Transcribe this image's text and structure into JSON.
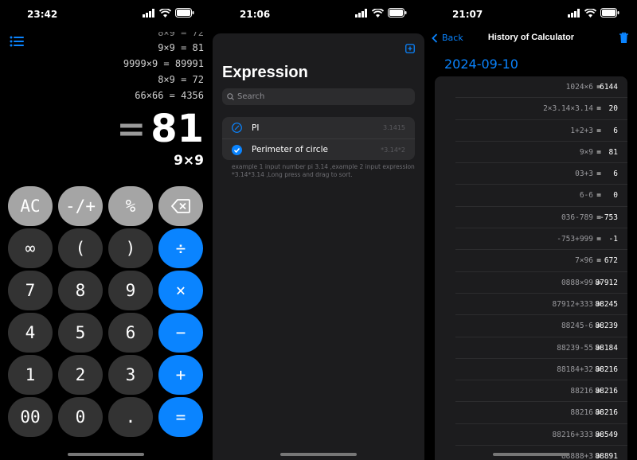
{
  "screens": {
    "calculator": {
      "time": "23:42",
      "history": [
        {
          "expr": "8×9 = 72",
          "cut": true
        },
        {
          "expr": "9×9 = 81"
        },
        {
          "expr": "9999×9 = 89991"
        },
        {
          "expr": "8×9 = 72"
        },
        {
          "expr": "66×66 = 4356"
        }
      ],
      "result_eq": "=",
      "result": "81",
      "expression": "9×9",
      "keys": [
        {
          "label": "AC",
          "kind": "fn",
          "name": "ac-key"
        },
        {
          "label": "-/+",
          "kind": "fn",
          "name": "negate-key"
        },
        {
          "label": "%",
          "kind": "fn",
          "name": "percent-key"
        },
        {
          "label": "",
          "kind": "fn",
          "name": "backspace-key",
          "icon": "delete-left-icon"
        },
        {
          "label": "∞",
          "kind": "num",
          "name": "infinity-key"
        },
        {
          "label": "(",
          "kind": "num",
          "name": "open-paren-key"
        },
        {
          "label": ")",
          "kind": "num",
          "name": "close-paren-key"
        },
        {
          "label": "÷",
          "kind": "op",
          "name": "divide-key"
        },
        {
          "label": "7",
          "kind": "num",
          "name": "digit-7-key"
        },
        {
          "label": "8",
          "kind": "num",
          "name": "digit-8-key"
        },
        {
          "label": "9",
          "kind": "num",
          "name": "digit-9-key"
        },
        {
          "label": "×",
          "kind": "op",
          "name": "multiply-key"
        },
        {
          "label": "4",
          "kind": "num",
          "name": "digit-4-key"
        },
        {
          "label": "5",
          "kind": "num",
          "name": "digit-5-key"
        },
        {
          "label": "6",
          "kind": "num",
          "name": "digit-6-key"
        },
        {
          "label": "−",
          "kind": "op",
          "name": "minus-key"
        },
        {
          "label": "1",
          "kind": "num",
          "name": "digit-1-key"
        },
        {
          "label": "2",
          "kind": "num",
          "name": "digit-2-key"
        },
        {
          "label": "3",
          "kind": "num",
          "name": "digit-3-key"
        },
        {
          "label": "+",
          "kind": "op",
          "name": "plus-key"
        },
        {
          "label": "00",
          "kind": "num",
          "name": "double-zero-key"
        },
        {
          "label": "0",
          "kind": "num",
          "name": "digit-0-key"
        },
        {
          "label": ".",
          "kind": "num",
          "name": "decimal-key"
        },
        {
          "label": "=",
          "kind": "op",
          "name": "equals-key"
        }
      ]
    },
    "expressions": {
      "time": "21:06",
      "title": "Expression",
      "search_placeholder": "Search",
      "items": [
        {
          "label": "PI",
          "value": "3.1415",
          "checked": false
        },
        {
          "label": "Perimeter of circle",
          "value": "*3.14*2",
          "checked": true
        }
      ],
      "hint": "example 1 input number pi 3.14 ,example 2 input expression *3.14*3.14 ,Long press and drag to sort."
    },
    "history": {
      "time": "21:07",
      "back_label": "Back",
      "title": "History of Calculator",
      "date": "2024-09-10",
      "rows": [
        {
          "lhs": "1024×6",
          "rhs": "6144"
        },
        {
          "lhs": "2×3.14×3.14",
          "rhs": "20"
        },
        {
          "lhs": "1+2+3",
          "rhs": "6"
        },
        {
          "lhs": "9×9",
          "rhs": "81"
        },
        {
          "lhs": "03+3",
          "rhs": "6"
        },
        {
          "lhs": "6-6",
          "rhs": "0"
        },
        {
          "lhs": "036-789",
          "rhs": "-753"
        },
        {
          "lhs": "-753+999",
          "rhs": "-1"
        },
        {
          "lhs": "7×96",
          "rhs": "672"
        },
        {
          "lhs": "0888×99",
          "rhs": "87912"
        },
        {
          "lhs": "87912+333",
          "rhs": "88245"
        },
        {
          "lhs": "88245-6",
          "rhs": "88239"
        },
        {
          "lhs": "88239-55",
          "rhs": "88184"
        },
        {
          "lhs": "88184+32",
          "rhs": "88216"
        },
        {
          "lhs": "88216",
          "rhs": "88216"
        },
        {
          "lhs": "88216",
          "rhs": "88216"
        },
        {
          "lhs": "88216+333",
          "rhs": "88549"
        },
        {
          "lhs": "88888+3",
          "rhs": "88891"
        }
      ]
    }
  },
  "colors": {
    "accent": "#0a84ff",
    "function_key": "#a5a5a5",
    "number_key": "#333333",
    "sheet": "#1c1c1e"
  }
}
